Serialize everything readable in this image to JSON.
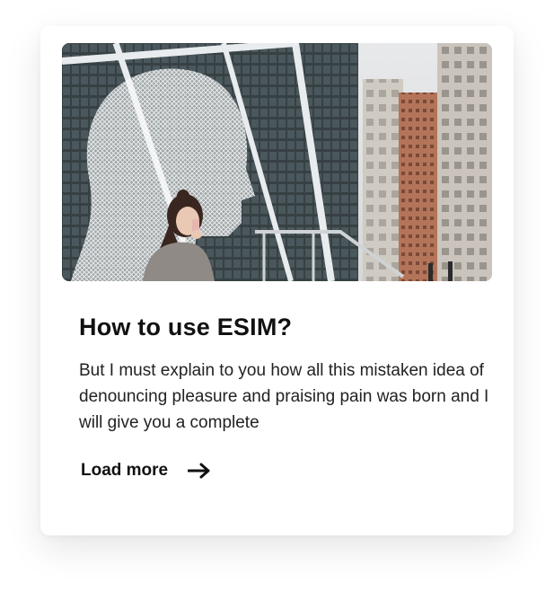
{
  "card": {
    "image": {
      "alt": "Woman talking on phone in front of large wireframe head sculpture among city buildings",
      "icon": "photo"
    },
    "title": "How to use ESIM?",
    "description": "But I must explain to you how all this mistaken idea of denouncing pleasure and praising pain was born and I will give you a complete",
    "cta_label": "Load more",
    "cta_icon": "arrow-right-icon"
  },
  "colors": {
    "title": "#111111",
    "text": "#222222",
    "card_bg": "#ffffff"
  }
}
